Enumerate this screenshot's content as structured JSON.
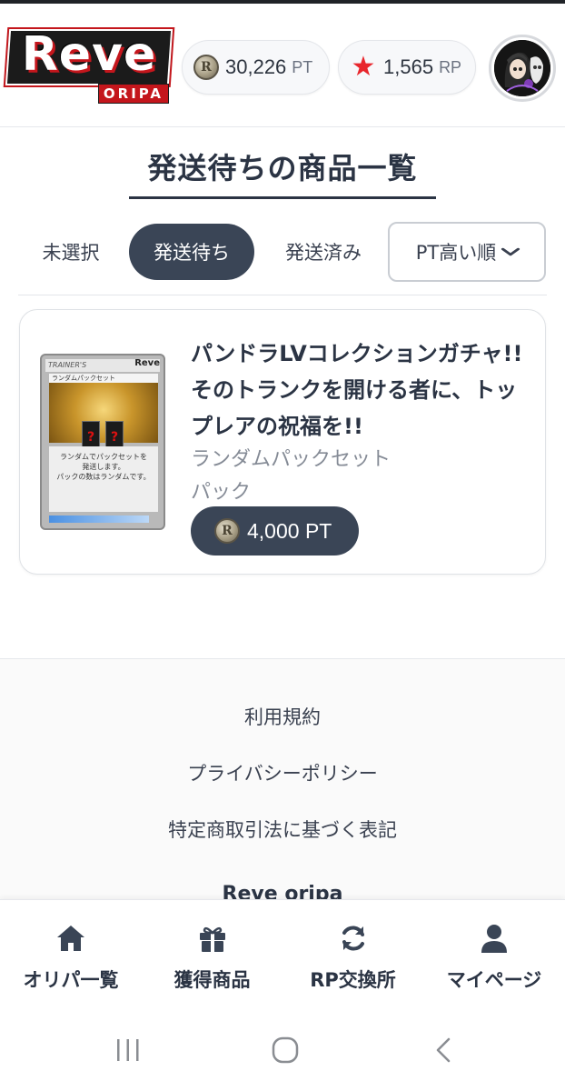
{
  "header": {
    "logo_text": "Reve",
    "logo_sub": "ORIPA",
    "pt_balance": "30,226",
    "pt_unit": "PT",
    "rp_balance": "1,565",
    "rp_unit": "RP",
    "coin_glyph": "R",
    "star_glyph": "★"
  },
  "page": {
    "title": "発送待ちの商品一覧"
  },
  "tabs": [
    {
      "label": "未選択",
      "active": false
    },
    {
      "label": "発送待ち",
      "active": true
    },
    {
      "label": "発送済み",
      "active": false
    }
  ],
  "sort": {
    "label": "PT高い順"
  },
  "product": {
    "title": "パンドラLVコレクションガチャ!! そのトランクを開ける者に、トップレアの祝福を!!",
    "subtitle": "ランダムパックセット",
    "type": "パック",
    "price": "4,000 PT",
    "card_image": {
      "header": "TRAINER'S",
      "brand": "Reve",
      "name": "ランダムパックセット",
      "mystery_mark": "?",
      "text_line1": "ランダムでパックセットを",
      "text_line2": "発送します。",
      "text_line3": "パックの数はランダムです。"
    }
  },
  "footer": {
    "links": [
      "利用規約",
      "プライバシーポリシー",
      "特定商取引法に基づく表記"
    ],
    "brand": "Reve oripa"
  },
  "bottom_nav": [
    {
      "label": "オリパ一覧",
      "icon": "home-icon"
    },
    {
      "label": "獲得商品",
      "icon": "gift-icon"
    },
    {
      "label": "RP交換所",
      "icon": "refresh-icon"
    },
    {
      "label": "マイページ",
      "icon": "user-icon"
    }
  ],
  "colors": {
    "accent_dark": "#3a4556",
    "text": "#2b3444",
    "muted": "#858b96",
    "star": "#e8262c",
    "logo_red": "#c4161c"
  }
}
